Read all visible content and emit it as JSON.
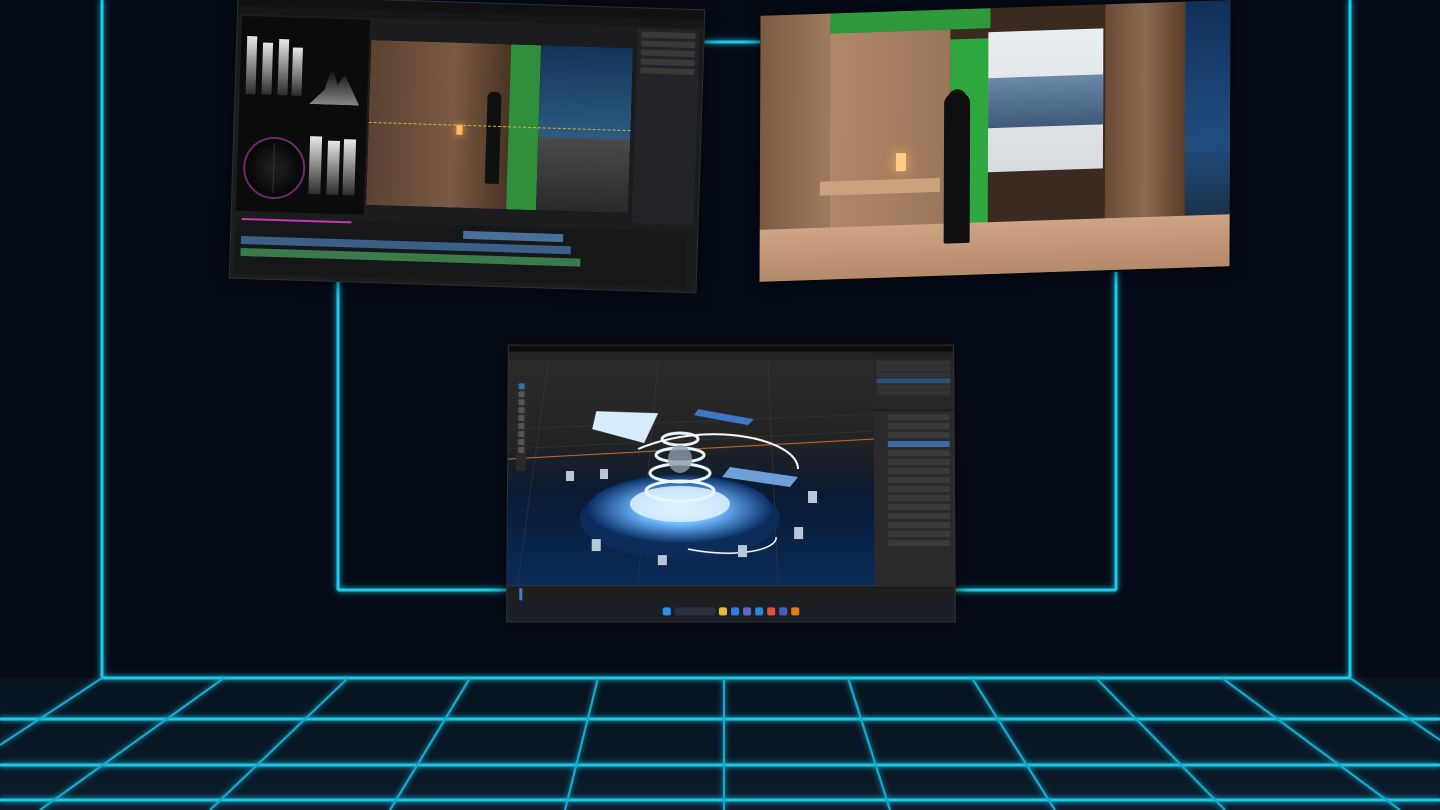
{
  "environment": {
    "background_color": "#050c18",
    "neon_color": "#19c8e8",
    "grid_color": "#139fc0"
  },
  "windows": {
    "video_editor": {
      "icon": "color-grading-app-icon",
      "menu_items": [
        "",
        "",
        "",
        "",
        "",
        ""
      ],
      "viewer": {
        "subject": "woman-in-dark-suit",
        "scene": "wood-paneled-room-with-green-screen-and-city-view"
      }
    },
    "camera_preview": {
      "subject": "woman-in-dark-suit",
      "scene": "wood-paneled-room-with-green-screen-and-city-view"
    },
    "blender": {
      "icon": "blender-icon",
      "workspace_tabs": [
        "",
        "",
        "",
        "",
        "",
        "",
        "",
        "",
        "",
        ""
      ],
      "viewport_scene": "glowing-blue-circular-stage-with-rings",
      "accent_color": "#3d6ba8",
      "taskbar_icons": [
        "windows-start-icon",
        "search-icon",
        "file-explorer-icon",
        "browser-icon",
        "store-icon",
        "mail-icon",
        "chrome-icon",
        "teams-icon"
      ]
    }
  }
}
